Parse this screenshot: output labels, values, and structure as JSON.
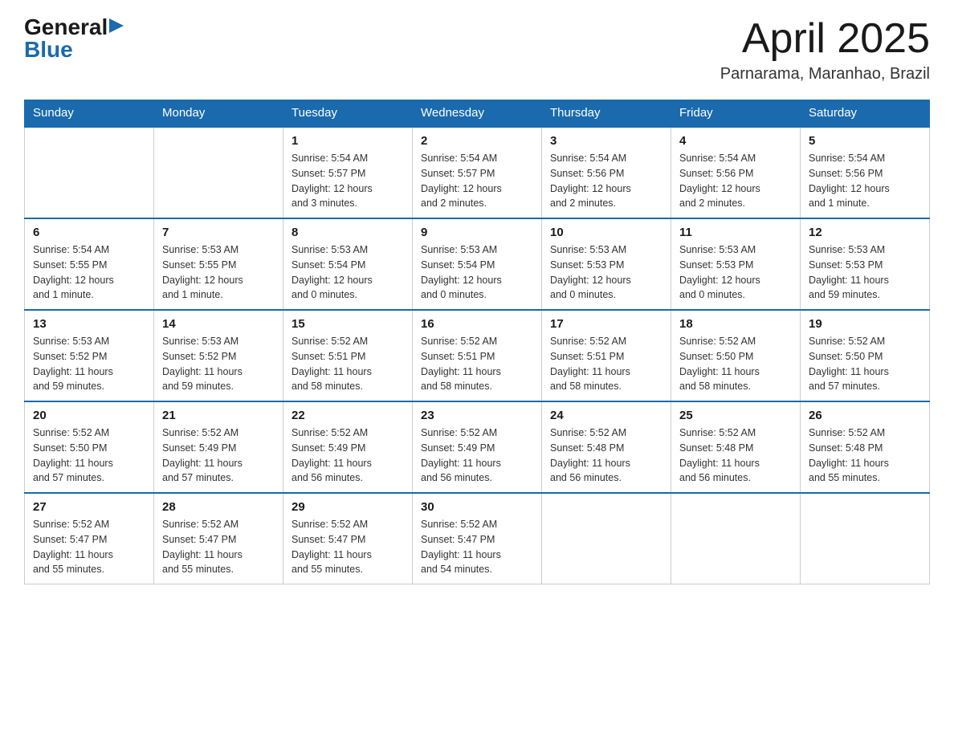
{
  "logo": {
    "general": "General",
    "blue": "Blue",
    "triangle": "▶"
  },
  "title": "April 2025",
  "location": "Parnarama, Maranhao, Brazil",
  "days_of_week": [
    "Sunday",
    "Monday",
    "Tuesday",
    "Wednesday",
    "Thursday",
    "Friday",
    "Saturday"
  ],
  "weeks": [
    [
      {
        "day": "",
        "info": ""
      },
      {
        "day": "",
        "info": ""
      },
      {
        "day": "1",
        "info": "Sunrise: 5:54 AM\nSunset: 5:57 PM\nDaylight: 12 hours\nand 3 minutes."
      },
      {
        "day": "2",
        "info": "Sunrise: 5:54 AM\nSunset: 5:57 PM\nDaylight: 12 hours\nand 2 minutes."
      },
      {
        "day": "3",
        "info": "Sunrise: 5:54 AM\nSunset: 5:56 PM\nDaylight: 12 hours\nand 2 minutes."
      },
      {
        "day": "4",
        "info": "Sunrise: 5:54 AM\nSunset: 5:56 PM\nDaylight: 12 hours\nand 2 minutes."
      },
      {
        "day": "5",
        "info": "Sunrise: 5:54 AM\nSunset: 5:56 PM\nDaylight: 12 hours\nand 1 minute."
      }
    ],
    [
      {
        "day": "6",
        "info": "Sunrise: 5:54 AM\nSunset: 5:55 PM\nDaylight: 12 hours\nand 1 minute."
      },
      {
        "day": "7",
        "info": "Sunrise: 5:53 AM\nSunset: 5:55 PM\nDaylight: 12 hours\nand 1 minute."
      },
      {
        "day": "8",
        "info": "Sunrise: 5:53 AM\nSunset: 5:54 PM\nDaylight: 12 hours\nand 0 minutes."
      },
      {
        "day": "9",
        "info": "Sunrise: 5:53 AM\nSunset: 5:54 PM\nDaylight: 12 hours\nand 0 minutes."
      },
      {
        "day": "10",
        "info": "Sunrise: 5:53 AM\nSunset: 5:53 PM\nDaylight: 12 hours\nand 0 minutes."
      },
      {
        "day": "11",
        "info": "Sunrise: 5:53 AM\nSunset: 5:53 PM\nDaylight: 12 hours\nand 0 minutes."
      },
      {
        "day": "12",
        "info": "Sunrise: 5:53 AM\nSunset: 5:53 PM\nDaylight: 11 hours\nand 59 minutes."
      }
    ],
    [
      {
        "day": "13",
        "info": "Sunrise: 5:53 AM\nSunset: 5:52 PM\nDaylight: 11 hours\nand 59 minutes."
      },
      {
        "day": "14",
        "info": "Sunrise: 5:53 AM\nSunset: 5:52 PM\nDaylight: 11 hours\nand 59 minutes."
      },
      {
        "day": "15",
        "info": "Sunrise: 5:52 AM\nSunset: 5:51 PM\nDaylight: 11 hours\nand 58 minutes."
      },
      {
        "day": "16",
        "info": "Sunrise: 5:52 AM\nSunset: 5:51 PM\nDaylight: 11 hours\nand 58 minutes."
      },
      {
        "day": "17",
        "info": "Sunrise: 5:52 AM\nSunset: 5:51 PM\nDaylight: 11 hours\nand 58 minutes."
      },
      {
        "day": "18",
        "info": "Sunrise: 5:52 AM\nSunset: 5:50 PM\nDaylight: 11 hours\nand 58 minutes."
      },
      {
        "day": "19",
        "info": "Sunrise: 5:52 AM\nSunset: 5:50 PM\nDaylight: 11 hours\nand 57 minutes."
      }
    ],
    [
      {
        "day": "20",
        "info": "Sunrise: 5:52 AM\nSunset: 5:50 PM\nDaylight: 11 hours\nand 57 minutes."
      },
      {
        "day": "21",
        "info": "Sunrise: 5:52 AM\nSunset: 5:49 PM\nDaylight: 11 hours\nand 57 minutes."
      },
      {
        "day": "22",
        "info": "Sunrise: 5:52 AM\nSunset: 5:49 PM\nDaylight: 11 hours\nand 56 minutes."
      },
      {
        "day": "23",
        "info": "Sunrise: 5:52 AM\nSunset: 5:49 PM\nDaylight: 11 hours\nand 56 minutes."
      },
      {
        "day": "24",
        "info": "Sunrise: 5:52 AM\nSunset: 5:48 PM\nDaylight: 11 hours\nand 56 minutes."
      },
      {
        "day": "25",
        "info": "Sunrise: 5:52 AM\nSunset: 5:48 PM\nDaylight: 11 hours\nand 56 minutes."
      },
      {
        "day": "26",
        "info": "Sunrise: 5:52 AM\nSunset: 5:48 PM\nDaylight: 11 hours\nand 55 minutes."
      }
    ],
    [
      {
        "day": "27",
        "info": "Sunrise: 5:52 AM\nSunset: 5:47 PM\nDaylight: 11 hours\nand 55 minutes."
      },
      {
        "day": "28",
        "info": "Sunrise: 5:52 AM\nSunset: 5:47 PM\nDaylight: 11 hours\nand 55 minutes."
      },
      {
        "day": "29",
        "info": "Sunrise: 5:52 AM\nSunset: 5:47 PM\nDaylight: 11 hours\nand 55 minutes."
      },
      {
        "day": "30",
        "info": "Sunrise: 5:52 AM\nSunset: 5:47 PM\nDaylight: 11 hours\nand 54 minutes."
      },
      {
        "day": "",
        "info": ""
      },
      {
        "day": "",
        "info": ""
      },
      {
        "day": "",
        "info": ""
      }
    ]
  ]
}
